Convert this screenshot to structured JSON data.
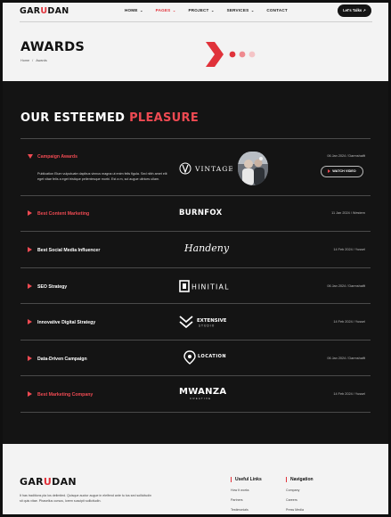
{
  "brand": {
    "logo_pre": "GAR",
    "logo_u": "U",
    "logo_post": "DAN"
  },
  "nav": {
    "items": [
      {
        "label": "HOME",
        "chevron": "⌄",
        "active": false
      },
      {
        "label": "PAGES",
        "chevron": "⌄",
        "active": true
      },
      {
        "label": "PROJECT",
        "chevron": "⌄",
        "active": false
      },
      {
        "label": "SERVICES",
        "chevron": "⌄",
        "active": false
      },
      {
        "label": "CONTACT",
        "chevron": "",
        "active": false
      }
    ],
    "cta_label": "Let's Talks ↗"
  },
  "hero": {
    "title": "AWARDS",
    "breadcrumb": [
      "Home",
      "/",
      "Awards"
    ]
  },
  "section": {
    "title_plain": "OUR ESTEEMED ",
    "title_highlight": "PLEASURE"
  },
  "awards": [
    {
      "name": "Campaign Awards",
      "brand": "VINTAGE",
      "date": "06 Jan 2024 / Darmshatft",
      "open": true,
      "description": "Publication Elum vulputuate dapibus vinnus magna ut enim felis figula. Sed nibh amet elit eget vitae felis a eget tristique pellentesque morbi. Est a m, sol augue ultrices ullam.",
      "button": "WATCH VIDEO"
    },
    {
      "name": "Best Content Marketing",
      "brand": "BURNFOX",
      "date": "11 Jan 2024 / Western",
      "open": false
    },
    {
      "name": "Best Social Media Influencer",
      "brand": "Handeny",
      "date": "14 Feb 2024 / Yussel",
      "open": false
    },
    {
      "name": "SEO Strategy",
      "brand": "HINITIAL",
      "date": "06 Jan 2024 / Darmshatft",
      "open": false
    },
    {
      "name": "Innovative Digital Strategy",
      "brand": "EXTENSIVE",
      "brand_sub": "STUDIO",
      "date": "14 Feb 2024 / Yussel",
      "open": false
    },
    {
      "name": "Data-Driven Campaign",
      "brand": "LOCATION",
      "date": "06 Jan 2024 / Darmshatft",
      "open": false
    },
    {
      "name": "Best Marketing Company",
      "brand": "MWANZA",
      "brand_sub": "CREATIVE",
      "date": "14 Feb 2024 / Yussel",
      "open": false
    }
  ],
  "footer": {
    "description": "It has traditions pla los delimited. Quisque auctor augue in eleifend ante tu tus sed sollicitudin sit quis vitae. Phasellus cursus, lorem suscipit sollicitudin.",
    "useful_title": "Useful Links",
    "useful_links": [
      "How It works",
      "Partners",
      "Testimonials"
    ],
    "nav_title": "Navigation",
    "nav_links": [
      "Company",
      "Careers",
      "Press Media"
    ]
  },
  "colors": {
    "accent": "#ee4a52",
    "dark": "#141414",
    "light": "#f3f3f3"
  }
}
